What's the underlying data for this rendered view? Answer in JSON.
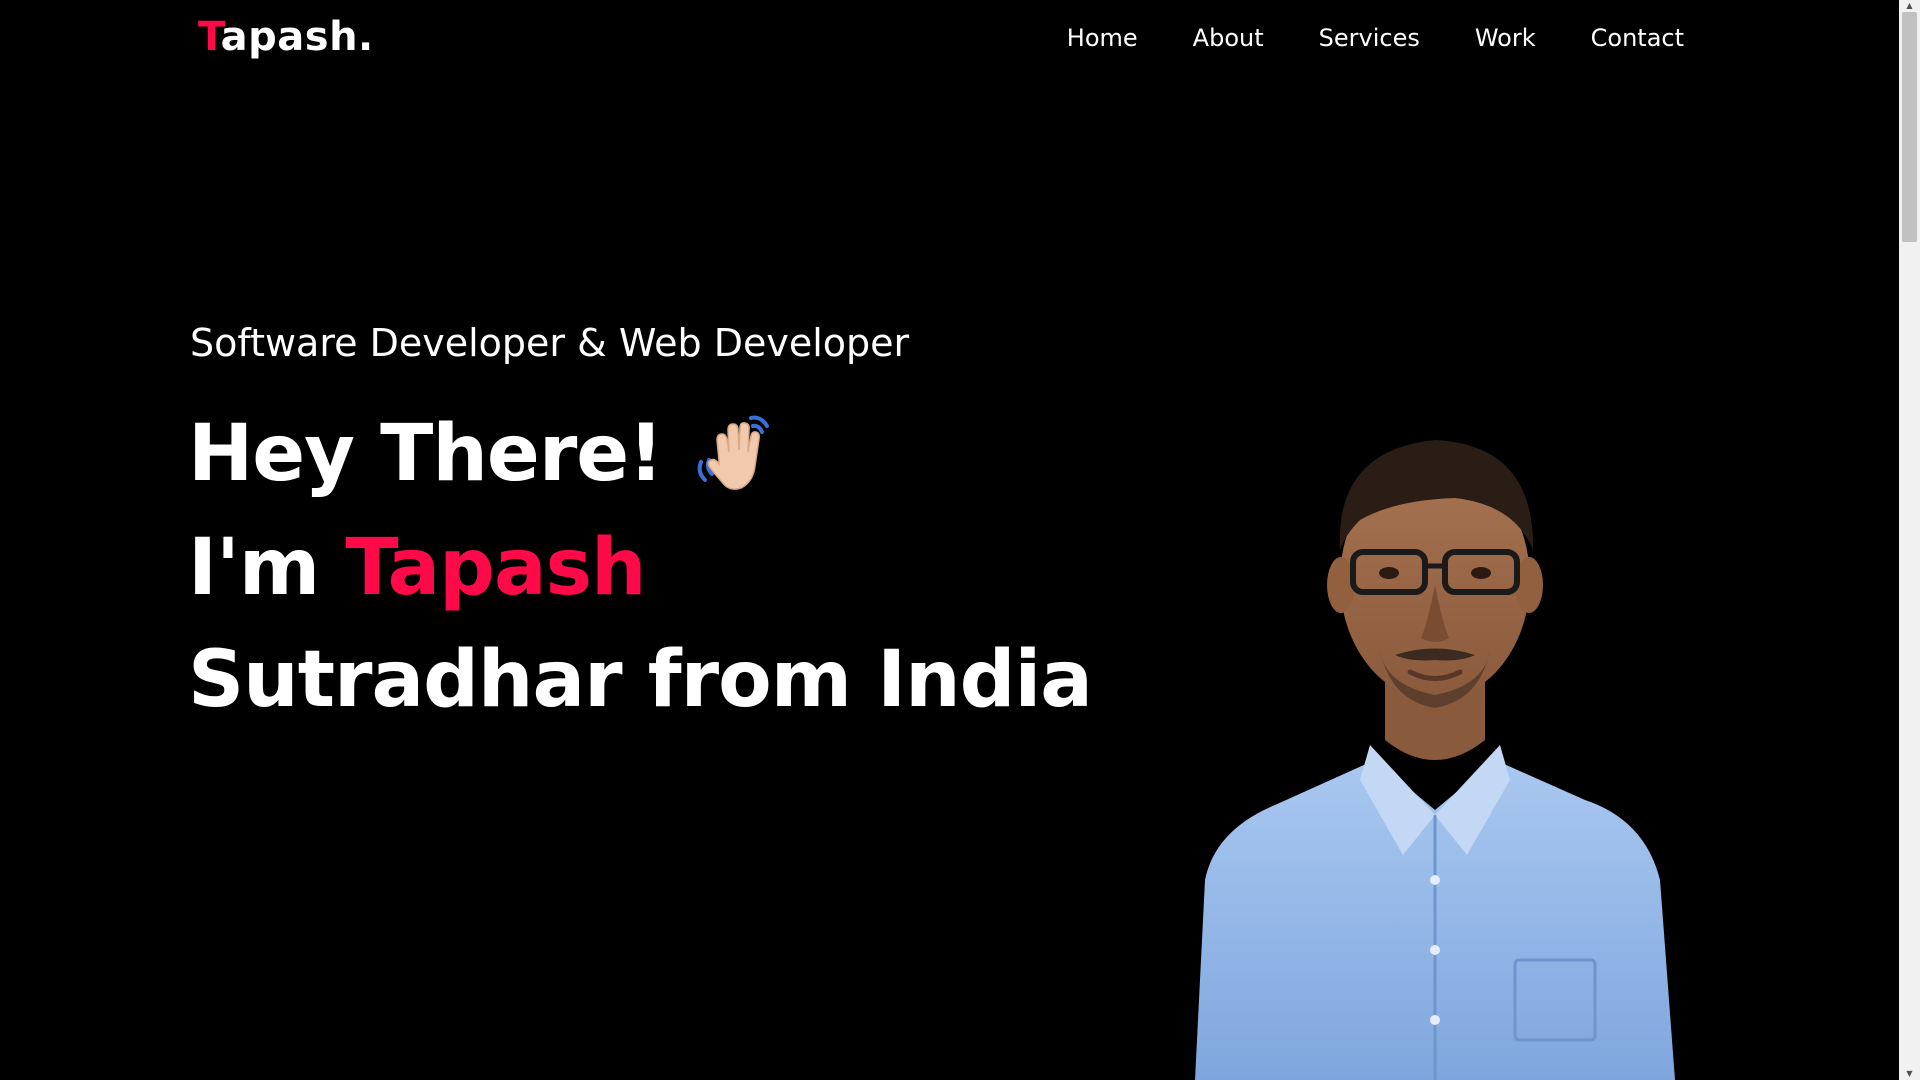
{
  "header": {
    "logo_first": "T",
    "logo_rest": "apash",
    "logo_dot": ".",
    "nav": [
      "Home",
      "About",
      "Services",
      "Work",
      "Contact"
    ]
  },
  "hero": {
    "subtitle": "Software Developer & Web Developer",
    "greeting": "Hey There!",
    "greeting_icon": "waving-hand-icon",
    "intro_prefix": "I'm ",
    "intro_name": "Tapash",
    "line3": "Sutradhar from India"
  },
  "colors": {
    "background": "#000000",
    "accent": "#ff0a48",
    "text": "#ffffff",
    "shirt": "#8fb6e8"
  },
  "icons": {
    "portrait": "profile-photo",
    "scroll_up": "scroll-up-arrow-icon",
    "scroll_down": "scroll-down-arrow-icon"
  }
}
